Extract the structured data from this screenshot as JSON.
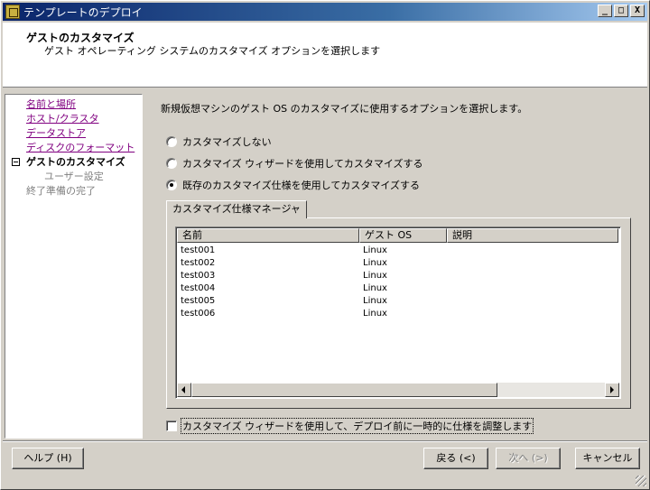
{
  "window": {
    "title": "テンプレートのデプロイ",
    "buttons": [
      "_",
      "□",
      "X"
    ]
  },
  "header": {
    "title": "ゲストのカスタマイズ",
    "subtitle": "ゲスト オペレーティング システムのカスタマイズ オプションを選択します"
  },
  "nav": {
    "items": [
      {
        "label": "名前と場所",
        "state": "link"
      },
      {
        "label": "ホスト/クラスタ",
        "state": "link"
      },
      {
        "label": "データストア",
        "state": "link"
      },
      {
        "label": "ディスクのフォーマット",
        "state": "link"
      },
      {
        "label": "ゲストのカスタマイズ",
        "state": "current"
      },
      {
        "label": "ユーザー設定",
        "state": "disabled"
      },
      {
        "label": "終了準備の完了",
        "state": "disabled"
      }
    ]
  },
  "main": {
    "instruction": "新規仮想マシンのゲスト OS のカスタマイズに使用するオプションを選択します。",
    "options": [
      {
        "label": "カスタマイズしない",
        "checked": false
      },
      {
        "label": "カスタマイズ ウィザードを使用してカスタマイズする",
        "checked": false
      },
      {
        "label": "既存のカスタマイズ仕様を使用してカスタマイズする",
        "checked": true
      }
    ],
    "tab_label": "カスタマイズ仕様マネージャ",
    "table": {
      "columns": [
        "名前",
        "ゲスト OS",
        "説明"
      ],
      "rows": [
        [
          "test001",
          "Linux",
          ""
        ],
        [
          "test002",
          "Linux",
          ""
        ],
        [
          "test003",
          "Linux",
          ""
        ],
        [
          "test004",
          "Linux",
          ""
        ],
        [
          "test005",
          "Linux",
          ""
        ],
        [
          "test006",
          "Linux",
          ""
        ]
      ]
    },
    "checkbox_label": "カスタマイズ ウィザードを使用して、デプロイ前に一時的に仕様を調整します",
    "checkbox_checked": false
  },
  "footer": {
    "help": "ヘルプ (H)",
    "back": "戻る (<)",
    "next": "次へ (>)",
    "cancel": "キャンセル"
  }
}
